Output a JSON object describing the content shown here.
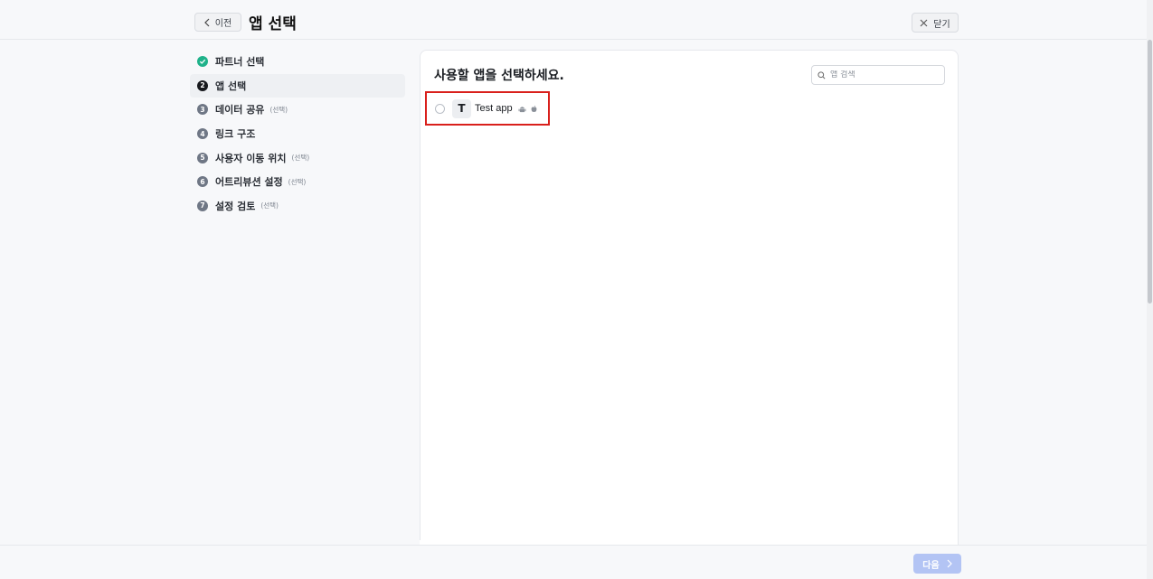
{
  "header": {
    "back_label": "이전",
    "title": "앱 선택",
    "close_label": "닫기"
  },
  "steps": [
    {
      "num": "✓",
      "label": "파트너 선택",
      "optional": "",
      "state": "done"
    },
    {
      "num": "2",
      "label": "앱 선택",
      "optional": "",
      "state": "active"
    },
    {
      "num": "3",
      "label": "데이터 공유",
      "optional": "(선택)",
      "state": "todo"
    },
    {
      "num": "4",
      "label": "링크 구조",
      "optional": "",
      "state": "todo"
    },
    {
      "num": "5",
      "label": "사용자 이동 위치",
      "optional": "(선택)",
      "state": "todo"
    },
    {
      "num": "6",
      "label": "어트리뷰션 설정",
      "optional": "(선택)",
      "state": "todo"
    },
    {
      "num": "7",
      "label": "설정 검토",
      "optional": "(선택)",
      "state": "todo"
    }
  ],
  "main": {
    "title": "사용할 앱을 선택하세요.",
    "search_placeholder": "앱 검색",
    "apps": [
      {
        "initial": "T",
        "name": "Test app",
        "platforms": [
          "android-icon",
          "apple-icon"
        ]
      }
    ]
  },
  "footer": {
    "next_label": "다음"
  },
  "colors": {
    "done": "#1fb28a",
    "active": "#17191d",
    "pending": "#6f7785",
    "highlight": "#d9201c",
    "next_disabled": "#b3c4f4"
  }
}
